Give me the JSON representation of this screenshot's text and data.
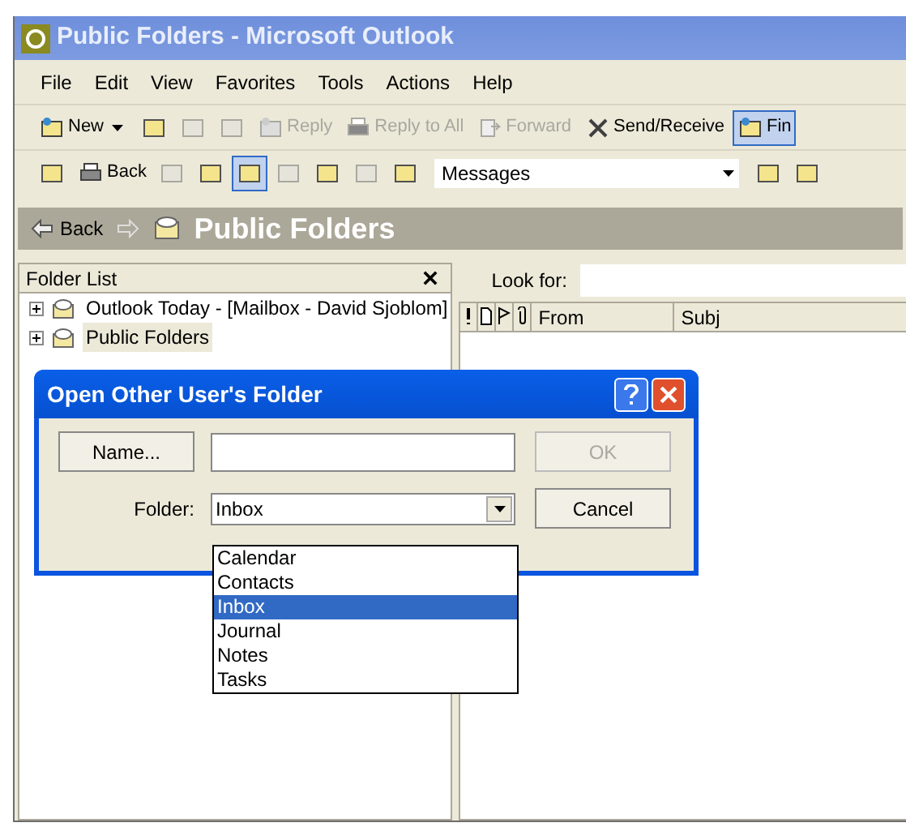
{
  "window": {
    "title": "Public Folders - Microsoft Outlook"
  },
  "menu": [
    "File",
    "Edit",
    "View",
    "Favorites",
    "Tools",
    "Actions",
    "Help"
  ],
  "toolbar": [
    {
      "kind": "dropdown",
      "label": "New",
      "disabled": false,
      "pressed": false
    },
    {
      "kind": "icon",
      "disabled": false,
      "pressed": false
    },
    {
      "kind": "icon",
      "disabled": true,
      "pressed": false
    },
    {
      "kind": "icon",
      "disabled": true,
      "pressed": false
    },
    {
      "kind": "button",
      "label": "Reply",
      "disabled": true,
      "pressed": false
    },
    {
      "kind": "button",
      "label": "Reply to All",
      "disabled": true,
      "pressed": false
    },
    {
      "kind": "button",
      "label": "Forward",
      "disabled": true,
      "pressed": false
    },
    {
      "kind": "button",
      "label": "Send/Receive",
      "disabled": false,
      "pressed": false
    },
    {
      "kind": "button",
      "label": "Fin",
      "disabled": false,
      "pressed": true
    }
  ],
  "advanced_toolbar": [
    {
      "kind": "icon",
      "disabled": false,
      "pressed": false
    },
    {
      "kind": "button",
      "label": "Back",
      "disabled": false,
      "pressed": false
    },
    {
      "kind": "icon",
      "disabled": true,
      "pressed": false
    },
    {
      "kind": "icon",
      "disabled": false,
      "pressed": false
    },
    {
      "kind": "icon",
      "disabled": false,
      "pressed": true
    },
    {
      "kind": "icon",
      "disabled": true,
      "pressed": false
    },
    {
      "kind": "icon",
      "disabled": false,
      "pressed": false
    },
    {
      "kind": "icon",
      "disabled": true,
      "pressed": false
    },
    {
      "kind": "icon",
      "disabled": false,
      "pressed": false
    },
    {
      "kind": "combo",
      "label": "Messages"
    },
    {
      "kind": "icon",
      "disabled": false,
      "pressed": false
    },
    {
      "kind": "icon",
      "disabled": false,
      "pressed": false
    }
  ],
  "pane_header": {
    "back": "Back",
    "title": "Public Folders"
  },
  "folder_list": {
    "title": "Folder List",
    "items": [
      {
        "label": "Outlook Today - [Mailbox - David Sjoblom]",
        "expanded": false,
        "selected": false
      },
      {
        "label": "Public Folders",
        "expanded": false,
        "selected": true
      }
    ]
  },
  "search": {
    "label": "Look for:"
  },
  "columns": [
    {
      "kind": "importance"
    },
    {
      "kind": "icon"
    },
    {
      "kind": "flag"
    },
    {
      "kind": "attachment"
    },
    {
      "kind": "text",
      "label": "From"
    },
    {
      "kind": "text",
      "label": "Subj"
    }
  ],
  "dialog": {
    "title": "Open Other User's Folder",
    "name_button": "Name...",
    "ok": {
      "label": "OK",
      "disabled": true
    },
    "cancel": "Cancel",
    "folder_label": "Folder:",
    "folder_value": "Inbox",
    "options": [
      {
        "label": "Calendar",
        "selected": false
      },
      {
        "label": "Contacts",
        "selected": false
      },
      {
        "label": "Inbox",
        "selected": true
      },
      {
        "label": "Journal",
        "selected": false
      },
      {
        "label": "Notes",
        "selected": false
      },
      {
        "label": "Tasks",
        "selected": false
      }
    ]
  }
}
